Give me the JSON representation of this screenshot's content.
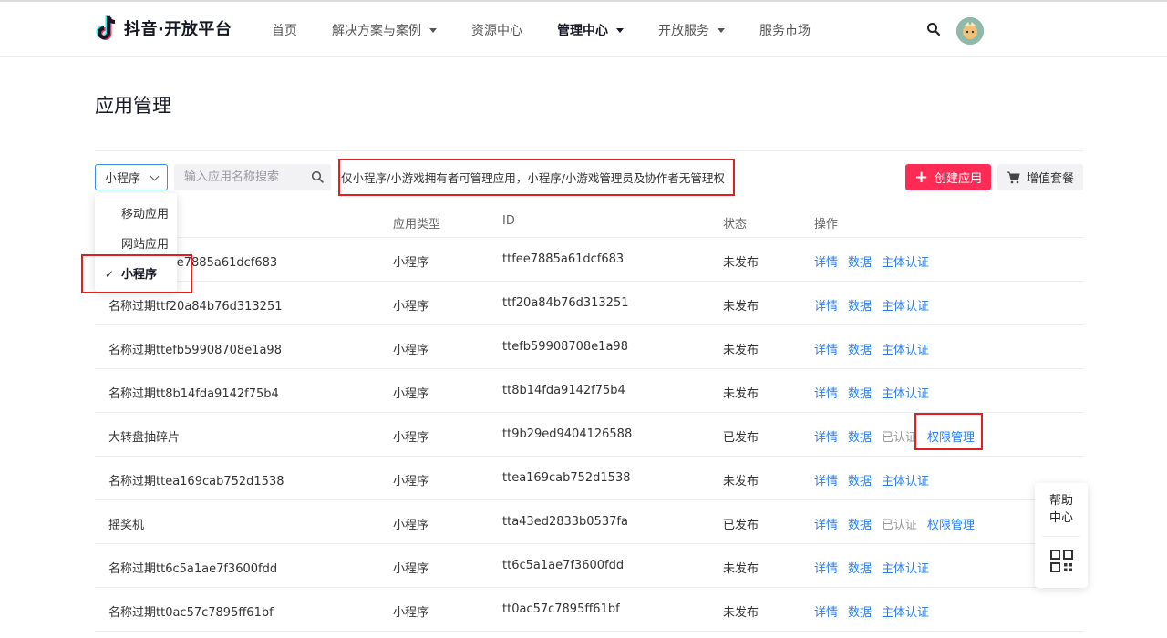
{
  "header": {
    "brand": "抖音·开放平台",
    "nav": [
      {
        "label": "首页",
        "dropdown": false,
        "active": false
      },
      {
        "label": "解决方案与案例",
        "dropdown": true,
        "active": false
      },
      {
        "label": "资源中心",
        "dropdown": false,
        "active": false
      },
      {
        "label": "管理中心",
        "dropdown": true,
        "active": true
      },
      {
        "label": "开放服务",
        "dropdown": true,
        "active": false
      },
      {
        "label": "服务市场",
        "dropdown": false,
        "active": false
      }
    ],
    "icons": [
      "search-icon",
      "avatar"
    ]
  },
  "page": {
    "title": "应用管理"
  },
  "toolbar": {
    "type_select_value": "小程序",
    "search_placeholder": "输入应用名称搜索",
    "notice": "仅小程序/小游戏拥有者可管理应用，小程序/小游戏管理员及协作者无管理权",
    "create_button": "创建应用",
    "vip_button": "增值套餐"
  },
  "dropdown": {
    "options": [
      "移动应用",
      "网站应用",
      "小程序"
    ],
    "selected": "小程序"
  },
  "table": {
    "headers": {
      "type": "应用类型",
      "id": "ID",
      "status": "状态",
      "ops": "操作"
    },
    "rows": [
      {
        "name": "名称过期ttfee7885a61dcf683",
        "type": "小程序",
        "id": "ttfee7885a61dcf683",
        "status": "未发布",
        "ops": [
          "详情",
          "数据",
          "主体认证"
        ]
      },
      {
        "name": "名称过期ttf20a84b76d313251",
        "type": "小程序",
        "id": "ttf20a84b76d313251",
        "status": "未发布",
        "ops": [
          "详情",
          "数据",
          "主体认证"
        ]
      },
      {
        "name": "名称过期ttefb59908708e1a98",
        "type": "小程序",
        "id": "ttefb59908708e1a98",
        "status": "未发布",
        "ops": [
          "详情",
          "数据",
          "主体认证"
        ]
      },
      {
        "name": "名称过期tt8b14fda9142f75b4",
        "type": "小程序",
        "id": "tt8b14fda9142f75b4",
        "status": "未发布",
        "ops": [
          "详情",
          "数据",
          "主体认证"
        ]
      },
      {
        "name": "大转盘抽碎片",
        "type": "小程序",
        "id": "tt9b29ed9404126588",
        "status": "已发布",
        "ops": [
          "详情",
          "数据",
          "已认证",
          "权限管理"
        ]
      },
      {
        "name": "名称过期ttea169cab752d1538",
        "type": "小程序",
        "id": "ttea169cab752d1538",
        "status": "未发布",
        "ops": [
          "详情",
          "数据",
          "主体认证"
        ]
      },
      {
        "name": "摇奖机",
        "type": "小程序",
        "id": "tta43ed2833b0537fa",
        "status": "已发布",
        "ops": [
          "详情",
          "数据",
          "已认证",
          "权限管理"
        ]
      },
      {
        "name": "名称过期tt6c5a1ae7f3600fdd",
        "type": "小程序",
        "id": "tt6c5a1ae7f3600fdd",
        "status": "未发布",
        "ops": [
          "详情",
          "数据",
          "主体认证"
        ]
      },
      {
        "name": "名称过期tt0ac57c7895ff61bf",
        "type": "小程序",
        "id": "tt0ac57c7895ff61bf",
        "status": "未发布",
        "ops": [
          "详情",
          "数据",
          "主体认证"
        ]
      }
    ]
  },
  "help": {
    "line1": "帮助",
    "line2": "中心"
  },
  "colors": {
    "accent": "#fe2c55",
    "link": "#2b7de9",
    "muted": "#999999",
    "highlight_border": "#e02020"
  }
}
